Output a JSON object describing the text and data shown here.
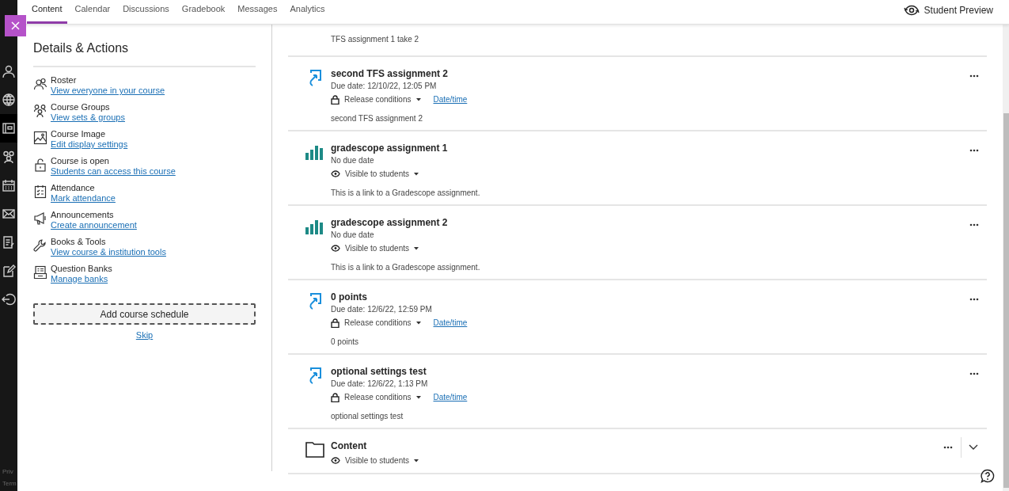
{
  "tabs": [
    {
      "label": "Content",
      "selected": true
    },
    {
      "label": "Calendar",
      "selected": false
    },
    {
      "label": "Discussions",
      "selected": false
    },
    {
      "label": "Gradebook",
      "selected": false
    },
    {
      "label": "Messages",
      "selected": false
    },
    {
      "label": "Analytics",
      "selected": false
    }
  ],
  "student_preview": "Student Preview",
  "rail": {
    "items": [
      {
        "kind": "person",
        "selected": false
      },
      {
        "kind": "globe",
        "selected": false
      },
      {
        "kind": "course",
        "selected": true
      },
      {
        "kind": "groups",
        "selected": false
      },
      {
        "kind": "calendar",
        "selected": false
      },
      {
        "kind": "mail",
        "selected": false
      },
      {
        "kind": "grades",
        "selected": false
      },
      {
        "kind": "edit",
        "selected": false
      },
      {
        "kind": "exit",
        "selected": false
      }
    ],
    "footer": [
      "Priv",
      "Term"
    ]
  },
  "details": {
    "title": "Details & Actions",
    "actions": [
      {
        "kind": "roster",
        "label": "Roster",
        "link": "View everyone in your course"
      },
      {
        "kind": "groups",
        "label": "Course Groups",
        "link": "View sets & groups"
      },
      {
        "kind": "image",
        "label": "Course Image",
        "link": "Edit display settings"
      },
      {
        "kind": "open",
        "label": "Course is open",
        "link": "Students can access this course"
      },
      {
        "kind": "attendance",
        "label": "Attendance",
        "link": "Mark attendance"
      },
      {
        "kind": "announce",
        "label": "Announcements",
        "link": "Create announcement"
      },
      {
        "kind": "tools",
        "label": "Books & Tools",
        "link": "View course & institution tools"
      },
      {
        "kind": "banks",
        "label": "Question Banks",
        "link": "Manage banks"
      }
    ],
    "schedule_button": "Add course schedule",
    "skip_link": "Skip"
  },
  "content": [
    {
      "kind": "partial",
      "description": "TFS assignment 1 take 2"
    },
    {
      "kind": "assignment",
      "title": "second TFS assignment 2",
      "due": "Due date: 12/10/22, 12:05 PM",
      "visibility": {
        "kind": "release",
        "label": "Release conditions"
      },
      "date_link": "Date/time",
      "description": "second TFS assignment 2"
    },
    {
      "kind": "gradescope",
      "title": "gradescope assignment 1",
      "due": "No due date",
      "visibility": {
        "kind": "visible",
        "label": "Visible to students"
      },
      "description": "This is a link to a Gradescope assignment."
    },
    {
      "kind": "gradescope",
      "title": "gradescope assignment 2",
      "due": "No due date",
      "visibility": {
        "kind": "visible",
        "label": "Visible to students"
      },
      "description": "This is a link to a Gradescope assignment."
    },
    {
      "kind": "assignment",
      "title": "0 points",
      "due": "Due date: 12/6/22, 12:59 PM",
      "visibility": {
        "kind": "release",
        "label": "Release conditions"
      },
      "date_link": "Date/time",
      "description": "0 points"
    },
    {
      "kind": "assignment",
      "title": "optional settings test",
      "due": "Due date: 12/6/22, 1:13 PM",
      "visibility": {
        "kind": "release",
        "label": "Release conditions"
      },
      "date_link": "Date/time",
      "description": "optional settings test"
    },
    {
      "kind": "folder",
      "title": "Content",
      "visibility": {
        "kind": "visible",
        "label": "Visible to students"
      },
      "expandable": true
    }
  ]
}
